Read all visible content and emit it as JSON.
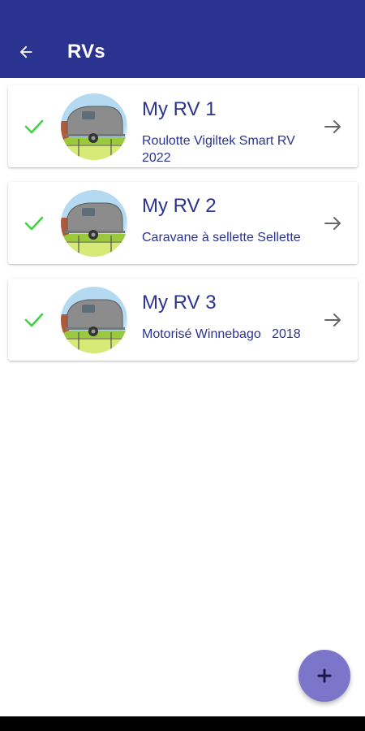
{
  "app": {
    "title": "RVs"
  },
  "icons": {
    "back": "arrow-left",
    "status": "check",
    "open": "arrow-right",
    "add": "plus"
  },
  "colors": {
    "appbar": "#2b3390",
    "text": "#2b3390",
    "check": "#3fd43f",
    "fab": "#7b76c9"
  },
  "rvs": [
    {
      "name": "My RV 1",
      "description": "Roulotte Vigiltek Smart RV 2022"
    },
    {
      "name": "My RV 2",
      "description": "Caravane à sellette Sellette"
    },
    {
      "name": "My RV 3",
      "description": "Motorisé Winnebago   2018"
    }
  ],
  "fab": {
    "label": "+"
  }
}
